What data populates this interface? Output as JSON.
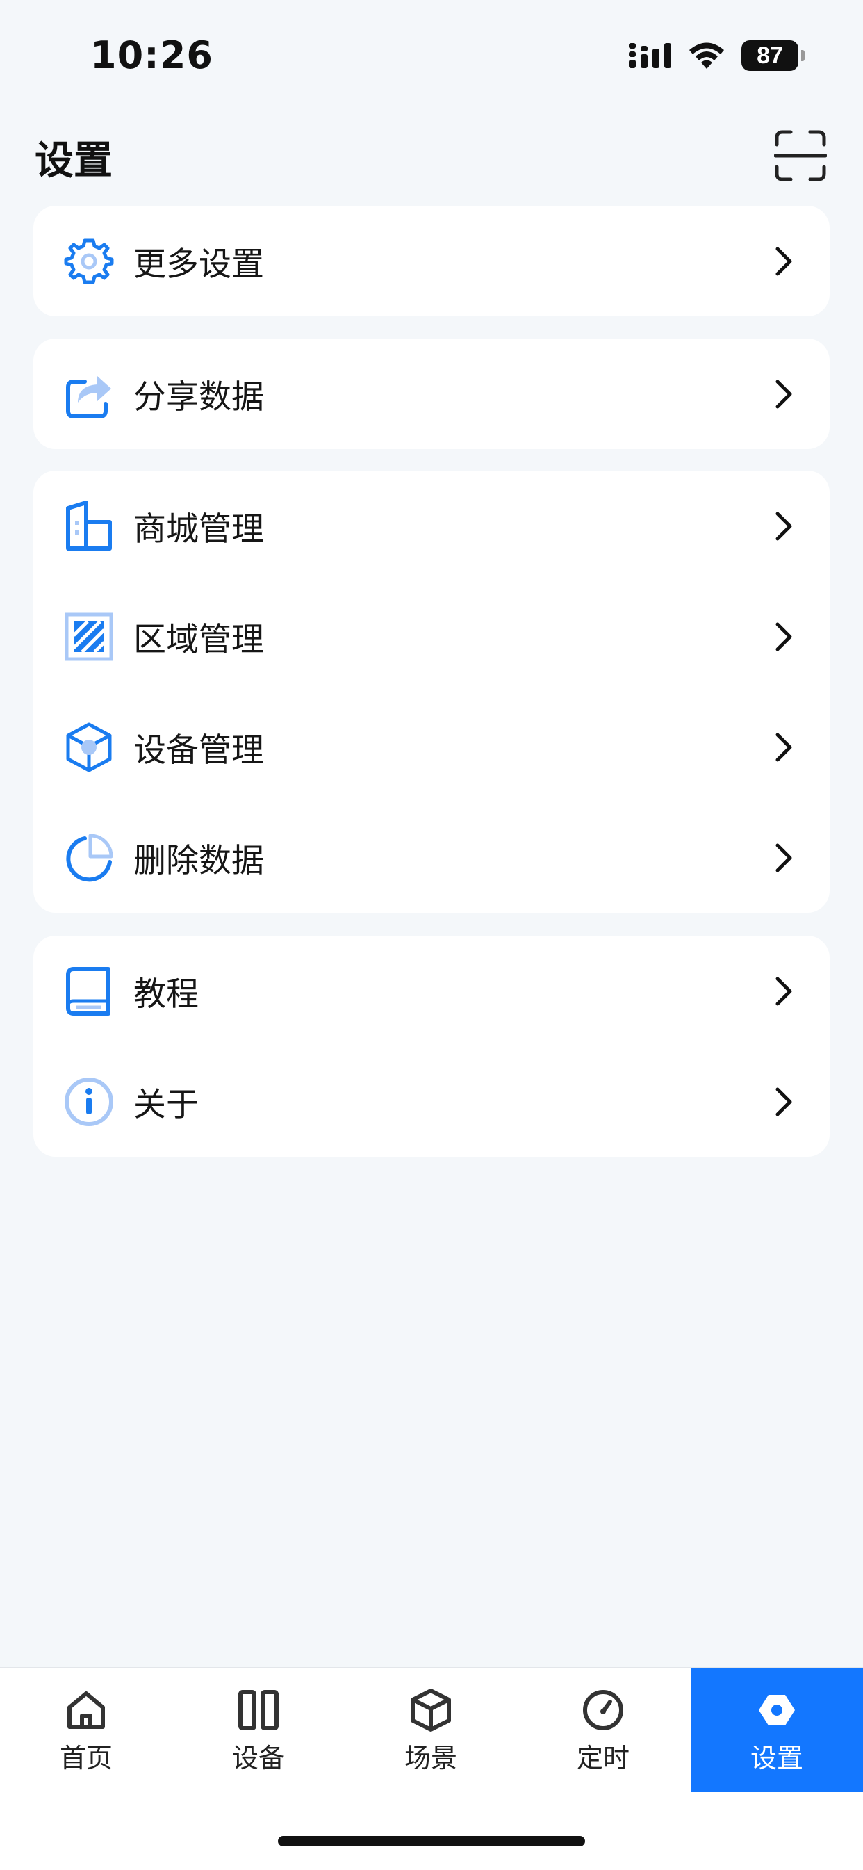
{
  "status_bar": {
    "time": "10:26",
    "battery_percent": "87",
    "icons": [
      "cellular-signal-icon",
      "wifi-icon",
      "battery-icon"
    ]
  },
  "header": {
    "title": "设置",
    "scan_icon": "scan-icon"
  },
  "sections": [
    {
      "items": [
        {
          "label": "更多设置",
          "icon": "gear-icon"
        }
      ]
    },
    {
      "items": [
        {
          "label": "分享数据",
          "icon": "share-icon"
        }
      ]
    },
    {
      "items": [
        {
          "label": "商城管理",
          "icon": "building-icon"
        },
        {
          "label": "区域管理",
          "icon": "area-icon"
        },
        {
          "label": "设备管理",
          "icon": "cube-icon"
        },
        {
          "label": "删除数据",
          "icon": "pie-icon"
        }
      ]
    },
    {
      "items": [
        {
          "label": "教程",
          "icon": "book-icon"
        },
        {
          "label": "关于",
          "icon": "info-icon"
        }
      ]
    }
  ],
  "tab_bar": {
    "tabs": [
      {
        "label": "首页",
        "icon": "home-icon",
        "active": false
      },
      {
        "label": "设备",
        "icon": "devices-icon",
        "active": false
      },
      {
        "label": "场景",
        "icon": "scene-cube-icon",
        "active": false
      },
      {
        "label": "定时",
        "icon": "timer-icon",
        "active": false
      },
      {
        "label": "设置",
        "icon": "settings-icon",
        "active": true
      }
    ]
  },
  "colors": {
    "accent": "#1377ff",
    "icon_blue": "#1a7cf0",
    "icon_light": "#a9c8f7",
    "background": "#f4f7fa",
    "card": "#ffffff"
  }
}
